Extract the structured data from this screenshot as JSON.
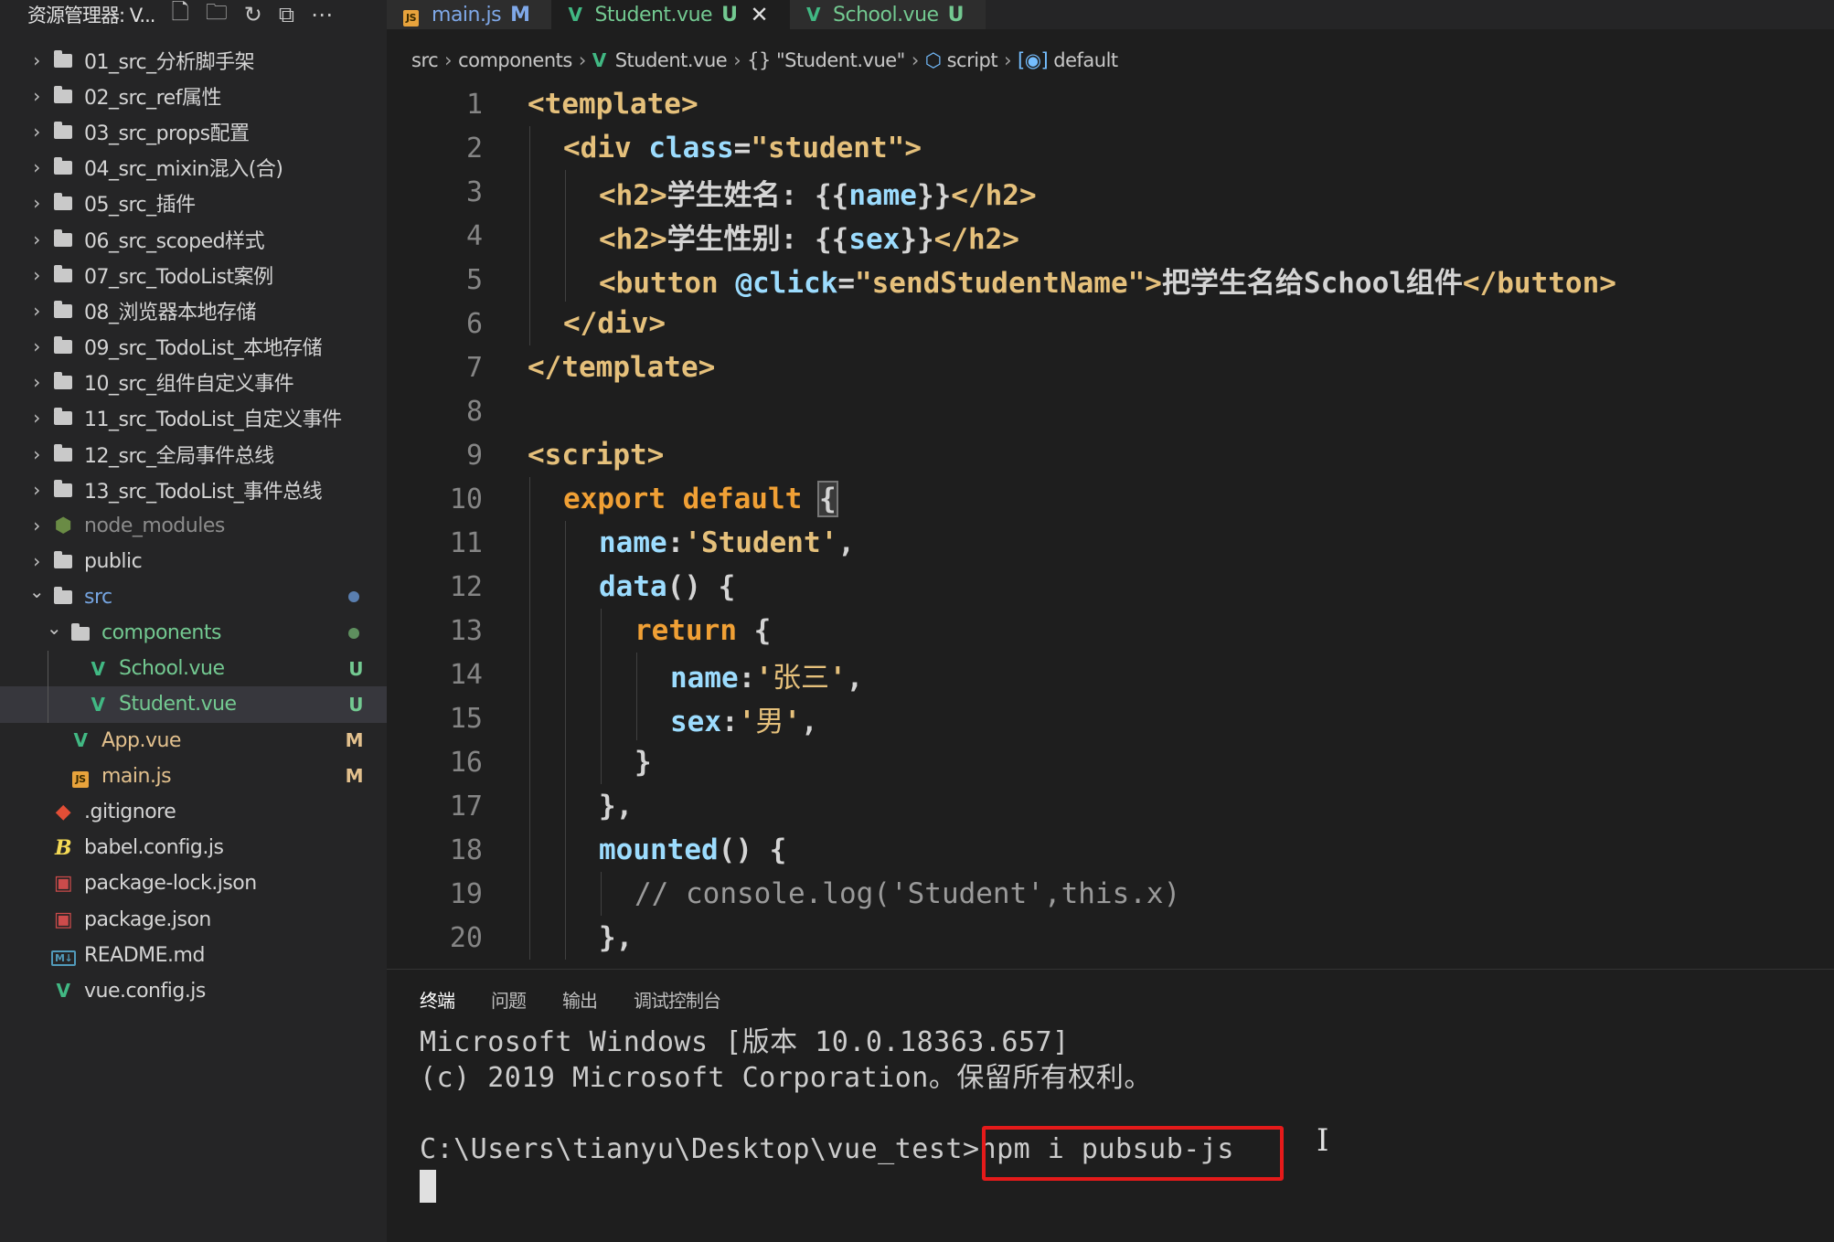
{
  "explorer": {
    "title": "资源管理器: V...",
    "header_icons": [
      "new-file-icon",
      "new-folder-icon",
      "refresh-icon",
      "collapse-all-icon",
      "more-icon"
    ],
    "items": [
      {
        "label": "01_src_分析脚手架",
        "type": "folder",
        "expanded": false,
        "depth": 0
      },
      {
        "label": "02_src_ref属性",
        "type": "folder",
        "expanded": false,
        "depth": 0
      },
      {
        "label": "03_src_props配置",
        "type": "folder",
        "expanded": false,
        "depth": 0
      },
      {
        "label": "04_src_mixin混入(合)",
        "type": "folder",
        "expanded": false,
        "depth": 0
      },
      {
        "label": "05_src_插件",
        "type": "folder",
        "expanded": false,
        "depth": 0
      },
      {
        "label": "06_src_scoped样式",
        "type": "folder",
        "expanded": false,
        "depth": 0
      },
      {
        "label": "07_src_TodoList案例",
        "type": "folder",
        "expanded": false,
        "depth": 0
      },
      {
        "label": "08_浏览器本地存储",
        "type": "folder",
        "expanded": false,
        "depth": 0
      },
      {
        "label": "09_src_TodoList_本地存储",
        "type": "folder",
        "expanded": false,
        "depth": 0
      },
      {
        "label": "10_src_组件自定义事件",
        "type": "folder",
        "expanded": false,
        "depth": 0
      },
      {
        "label": "11_src_TodoList_自定义事件",
        "type": "folder",
        "expanded": false,
        "depth": 0
      },
      {
        "label": "12_src_全局事件总线",
        "type": "folder",
        "expanded": false,
        "depth": 0
      },
      {
        "label": "13_src_TodoList_事件总线",
        "type": "folder",
        "expanded": false,
        "depth": 0
      },
      {
        "label": "node_modules",
        "type": "node-folder",
        "expanded": false,
        "depth": 0
      },
      {
        "label": "public",
        "type": "folder",
        "expanded": false,
        "depth": 0
      },
      {
        "label": "src",
        "type": "folder",
        "expanded": true,
        "depth": 0,
        "dot": "#5a7fb0"
      },
      {
        "label": "components",
        "type": "folder",
        "expanded": true,
        "depth": 1,
        "dot": "#5e8f5e"
      },
      {
        "label": "School.vue",
        "type": "vue",
        "depth": 2,
        "badge": "U"
      },
      {
        "label": "Student.vue",
        "type": "vue",
        "depth": 2,
        "badge": "U",
        "selected": true
      },
      {
        "label": "App.vue",
        "type": "vue",
        "depth": 1,
        "badge": "M"
      },
      {
        "label": "main.js",
        "type": "js",
        "depth": 1,
        "badge": "M"
      },
      {
        "label": ".gitignore",
        "type": "git",
        "depth": 0
      },
      {
        "label": "babel.config.js",
        "type": "babel",
        "depth": 0
      },
      {
        "label": "package-lock.json",
        "type": "json",
        "depth": 0
      },
      {
        "label": "package.json",
        "type": "json",
        "depth": 0
      },
      {
        "label": "README.md",
        "type": "md",
        "depth": 0
      },
      {
        "label": "vue.config.js",
        "type": "vue",
        "depth": 0
      }
    ]
  },
  "tabs": [
    {
      "label": "main.js",
      "status": "M",
      "icon": "js",
      "active": false
    },
    {
      "label": "Student.vue",
      "status": "U",
      "icon": "vue",
      "active": true,
      "close": "✕"
    },
    {
      "label": "School.vue",
      "status": "U",
      "icon": "vue",
      "active": false
    }
  ],
  "breadcrumb": {
    "src": "src",
    "components": "components",
    "file": "Student.vue",
    "object": "{} \"Student.vue\"",
    "script": "script",
    "default": "default"
  },
  "editor": {
    "lines": [
      {
        "n": "1",
        "indent": 0,
        "html": "<span class='tk-tag'>&lt;template&gt;</span>"
      },
      {
        "n": "2",
        "indent": 1,
        "html": "<span class='tk-tag'>&lt;div</span> <span class='tk-attr'>class</span><span class='tk-txt'>=</span><span class='tk-str'>\"student\"</span><span class='tk-tag'>&gt;</span>"
      },
      {
        "n": "3",
        "indent": 2,
        "html": "<span class='tk-tag'>&lt;h2&gt;</span><span class='tk-txt'>学生姓名: {{</span><span class='tk-attr'>name</span><span class='tk-txt'>}}</span><span class='tk-tag'>&lt;/h2&gt;</span>"
      },
      {
        "n": "4",
        "indent": 2,
        "html": "<span class='tk-tag'>&lt;h2&gt;</span><span class='tk-txt'>学生性别: {{</span><span class='tk-attr'>sex</span><span class='tk-txt'>}}</span><span class='tk-tag'>&lt;/h2&gt;</span>"
      },
      {
        "n": "5",
        "indent": 2,
        "html": "<span class='tk-tag'>&lt;button</span> <span class='tk-attr'>@click</span><span class='tk-txt'>=</span><span class='tk-str'>\"sendStudentName\"</span><span class='tk-tag'>&gt;</span><span class='tk-txt'>把学生名给School组件</span><span class='tk-tag'>&lt;/button&gt;</span>"
      },
      {
        "n": "6",
        "indent": 1,
        "html": "<span class='tk-tag'>&lt;/div&gt;</span>"
      },
      {
        "n": "7",
        "indent": 0,
        "html": "<span class='tk-tag'>&lt;/template&gt;</span>"
      },
      {
        "n": "8",
        "indent": 0,
        "html": ""
      },
      {
        "n": "9",
        "indent": 0,
        "html": "<span class='tk-tag'>&lt;script&gt;</span>"
      },
      {
        "n": "10",
        "indent": 1,
        "html": "<span class='tk-kw'>export default</span> <span class='tk-txt bracket-match'>{</span>"
      },
      {
        "n": "11",
        "indent": 2,
        "html": "<span class='tk-attr'>name</span><span class='tk-txt'>:</span><span class='tk-str'>'Student'</span><span class='tk-txt'>,</span>"
      },
      {
        "n": "12",
        "indent": 2,
        "html": "<span class='tk-fn'>data</span><span class='tk-txt'>() {</span>"
      },
      {
        "n": "13",
        "indent": 3,
        "html": "<span class='tk-kw'>return</span> <span class='tk-txt'>{</span>"
      },
      {
        "n": "14",
        "indent": 4,
        "html": "<span class='tk-attr'>name</span><span class='tk-txt'>:</span><span class='tk-str'>'</span><span class='tk-cjk'>张三</span><span class='tk-str'>'</span><span class='tk-txt'>,</span>"
      },
      {
        "n": "15",
        "indent": 4,
        "html": "<span class='tk-attr'>sex</span><span class='tk-txt'>:</span><span class='tk-str'>'</span><span class='tk-cjk'>男</span><span class='tk-str'>'</span><span class='tk-txt'>,</span>"
      },
      {
        "n": "16",
        "indent": 3,
        "html": "<span class='tk-txt'>}</span>"
      },
      {
        "n": "17",
        "indent": 2,
        "html": "<span class='tk-txt'>},</span>"
      },
      {
        "n": "18",
        "indent": 2,
        "html": "<span class='tk-fn'>mounted</span><span class='tk-txt'>() {</span>"
      },
      {
        "n": "19",
        "indent": 3,
        "html": "<span class='tk-cmt'>// console.log('Student',this.x)</span>"
      },
      {
        "n": "20",
        "indent": 2,
        "html": "<span class='tk-txt'>},</span>"
      }
    ]
  },
  "panel": {
    "tabs": [
      "终端",
      "问题",
      "输出",
      "调试控制台"
    ],
    "active_tab": "终端"
  },
  "terminal": {
    "line1": "Microsoft Windows [版本 10.0.18363.657]",
    "line2": "(c) 2019 Microsoft Corporation。保留所有权利。",
    "prompt": "C:\\Users\\tianyu\\Desktop\\vue_test>",
    "command": "npm i pubsub-js"
  },
  "colors": {
    "untracked": "#73c991",
    "modified": "#e2c08d",
    "vue_green": "#41b883",
    "highlight_box": "#e51a1a"
  }
}
